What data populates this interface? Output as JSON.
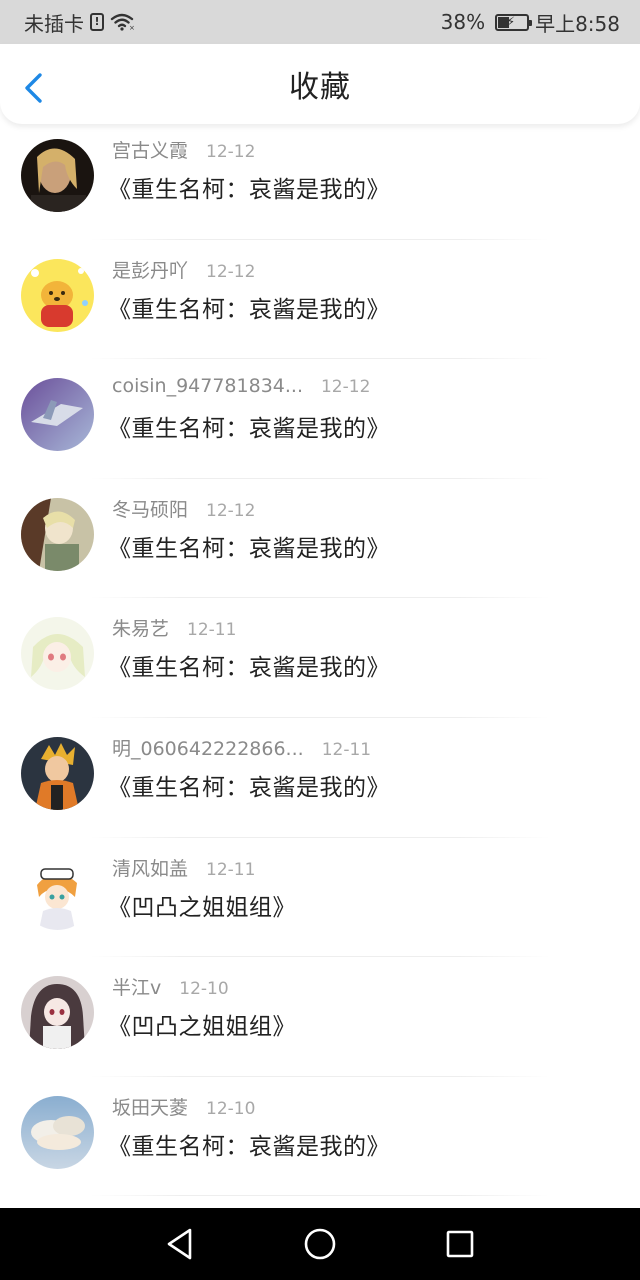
{
  "status": {
    "carrier": "未插卡",
    "battery_percent": "38%",
    "battery_level": 0.38,
    "time": "早上8:58"
  },
  "header": {
    "title": "收藏"
  },
  "colors": {
    "accent": "#1e88e5",
    "name_gray": "#8a8a8a",
    "date_gray": "#a8a8a8"
  },
  "items": [
    {
      "user": "宫古义霞",
      "date": "12-12",
      "title": "《重生名柯：哀酱是我的》"
    },
    {
      "user": "是彭丹吖",
      "date": "12-12",
      "title": "《重生名柯：哀酱是我的》"
    },
    {
      "user": "coisin_947781834...",
      "date": "12-12",
      "title": "《重生名柯：哀酱是我的》"
    },
    {
      "user": "冬马硕阳",
      "date": "12-12",
      "title": "《重生名柯：哀酱是我的》"
    },
    {
      "user": "朱易艺",
      "date": "12-11",
      "title": "《重生名柯：哀酱是我的》"
    },
    {
      "user": "明_060642222866...",
      "date": "12-11",
      "title": "《重生名柯：哀酱是我的》"
    },
    {
      "user": "清风如盖",
      "date": "12-11",
      "title": "《凹凸之姐姐组》"
    },
    {
      "user": "半江v",
      "date": "12-10",
      "title": "《凹凸之姐姐组》"
    },
    {
      "user": "坂田天菱",
      "date": "12-10",
      "title": "《重生名柯：哀酱是我的》"
    }
  ]
}
